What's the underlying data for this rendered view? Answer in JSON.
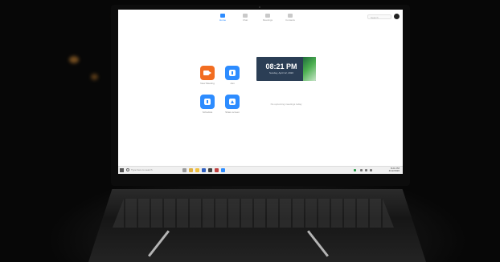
{
  "zoom": {
    "nav": [
      {
        "label": "Home",
        "active": true
      },
      {
        "label": "Chat",
        "active": false
      },
      {
        "label": "Meetings",
        "active": false
      },
      {
        "label": "Contacts",
        "active": false
      }
    ],
    "search_placeholder": "Search",
    "actions": {
      "new_meeting": "New Meeting",
      "join": "Join",
      "schedule": "Schedule",
      "share_screen": "Share screen"
    },
    "clock": {
      "time": "08:21 PM",
      "date": "Sunday, April 12, 2020"
    },
    "no_meetings_text": "No upcoming meetings today"
  },
  "taskbar": {
    "search_placeholder": "Type here to search",
    "time": "8:21 PM",
    "date": "4/12/2020"
  },
  "colors": {
    "zoom_blue": "#2d8cff",
    "zoom_orange": "#f26d21",
    "clock_card": "#2b3e55"
  }
}
